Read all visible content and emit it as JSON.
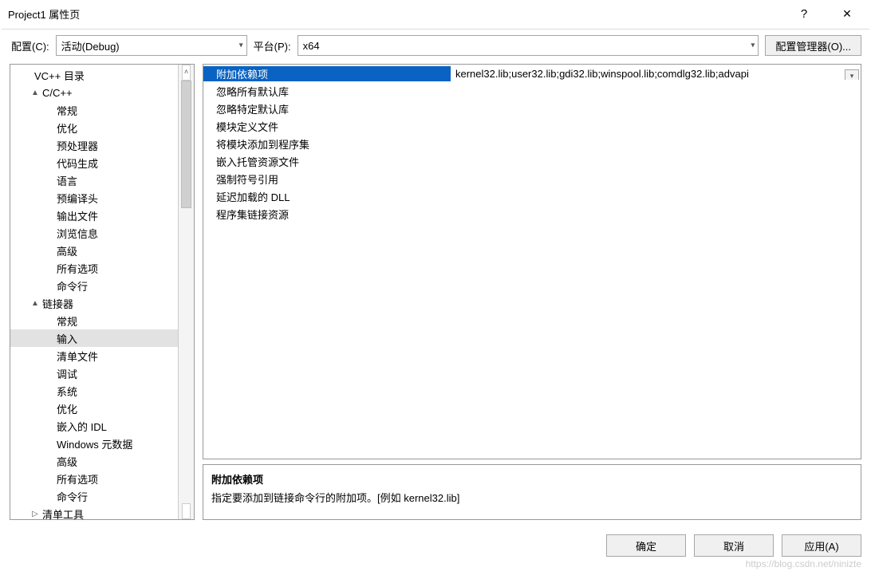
{
  "title": "Project1 属性页",
  "help_char": "?",
  "close_char": "✕",
  "config": {
    "label": "配置(C):",
    "value": "活动(Debug)"
  },
  "platform": {
    "label": "平台(P):",
    "value": "x64"
  },
  "config_mgr_label": "配置管理器(O)...",
  "tree": {
    "items": [
      {
        "label": "VC++ 目录",
        "indent": 1,
        "toggle": ""
      },
      {
        "label": "C/C++",
        "indent": 0,
        "toggle": "▲"
      },
      {
        "label": "常规",
        "indent": 2,
        "toggle": ""
      },
      {
        "label": "优化",
        "indent": 2,
        "toggle": ""
      },
      {
        "label": "预处理器",
        "indent": 2,
        "toggle": ""
      },
      {
        "label": "代码生成",
        "indent": 2,
        "toggle": ""
      },
      {
        "label": "语言",
        "indent": 2,
        "toggle": ""
      },
      {
        "label": "预编译头",
        "indent": 2,
        "toggle": ""
      },
      {
        "label": "输出文件",
        "indent": 2,
        "toggle": ""
      },
      {
        "label": "浏览信息",
        "indent": 2,
        "toggle": ""
      },
      {
        "label": "高级",
        "indent": 2,
        "toggle": ""
      },
      {
        "label": "所有选项",
        "indent": 2,
        "toggle": ""
      },
      {
        "label": "命令行",
        "indent": 2,
        "toggle": ""
      },
      {
        "label": "链接器",
        "indent": 0,
        "toggle": "▲"
      },
      {
        "label": "常规",
        "indent": 2,
        "toggle": ""
      },
      {
        "label": "输入",
        "indent": 2,
        "toggle": "",
        "selected": true
      },
      {
        "label": "清单文件",
        "indent": 2,
        "toggle": ""
      },
      {
        "label": "调试",
        "indent": 2,
        "toggle": ""
      },
      {
        "label": "系统",
        "indent": 2,
        "toggle": ""
      },
      {
        "label": "优化",
        "indent": 2,
        "toggle": ""
      },
      {
        "label": "嵌入的 IDL",
        "indent": 2,
        "toggle": ""
      },
      {
        "label": "Windows 元数据",
        "indent": 2,
        "toggle": ""
      },
      {
        "label": "高级",
        "indent": 2,
        "toggle": ""
      },
      {
        "label": "所有选项",
        "indent": 2,
        "toggle": ""
      },
      {
        "label": "命令行",
        "indent": 2,
        "toggle": ""
      },
      {
        "label": "清单工具",
        "indent": 0,
        "toggle": "▷"
      }
    ],
    "sb_up": "˄",
    "sb_dn": "˅"
  },
  "props": [
    {
      "label": "附加依赖项",
      "value": "kernel32.lib;user32.lib;gdi32.lib;winspool.lib;comdlg32.lib;advapi",
      "selected": true
    },
    {
      "label": "忽略所有默认库",
      "value": ""
    },
    {
      "label": "忽略特定默认库",
      "value": ""
    },
    {
      "label": "模块定义文件",
      "value": ""
    },
    {
      "label": "将模块添加到程序集",
      "value": ""
    },
    {
      "label": "嵌入托管资源文件",
      "value": ""
    },
    {
      "label": "强制符号引用",
      "value": ""
    },
    {
      "label": "延迟加载的 DLL",
      "value": ""
    },
    {
      "label": "程序集链接资源",
      "value": ""
    }
  ],
  "dropdown_char": "▾",
  "desc": {
    "title": "附加依赖项",
    "text": "指定要添加到链接命令行的附加项。[例如 kernel32.lib]"
  },
  "buttons": {
    "ok": "确定",
    "cancel": "取消",
    "apply": "应用(A)"
  },
  "watermark": "https://blog.csdn.net/ninizte"
}
